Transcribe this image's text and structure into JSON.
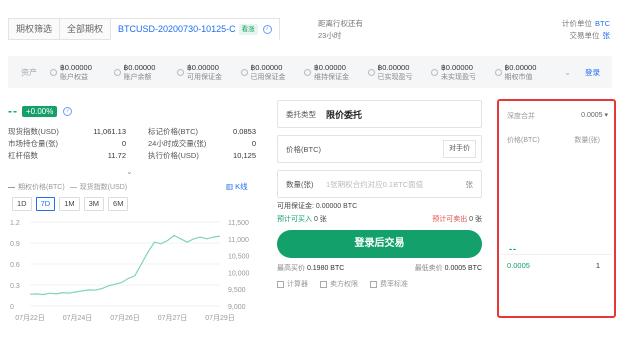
{
  "tabs": [
    {
      "label": "期权筛选"
    },
    {
      "label": "全部期权"
    },
    {
      "label": "BTCUSD-20200730-10125-C",
      "badge": "看涨"
    }
  ],
  "expiry": {
    "label": "距离行权还有",
    "value": "23小时"
  },
  "units": {
    "price_label": "计价单位",
    "price_value": "BTC",
    "trade_label": "交易单位",
    "trade_value": "张"
  },
  "assets": {
    "label": "资产",
    "items": [
      {
        "value": "฿0.00000",
        "name": "账户权益"
      },
      {
        "value": "฿0.00000",
        "name": "账户余额"
      },
      {
        "value": "฿0.00000",
        "name": "可用保证金"
      },
      {
        "value": "฿0.00000",
        "name": "已用保证金"
      },
      {
        "value": "฿0.00000",
        "name": "维持保证金"
      },
      {
        "value": "฿0.00000",
        "name": "已实现盈亏"
      },
      {
        "value": "฿0.00000",
        "name": "未实现盈亏"
      },
      {
        "value": "฿0.00000",
        "name": "期权市值"
      }
    ],
    "login": "登录"
  },
  "ticker": {
    "price": "--",
    "change": "+0.00%"
  },
  "stats": [
    {
      "k1": "现货指数(USD)",
      "v1": "11,061.13",
      "k2": "标记价格(BTC)",
      "v2": "0.0853"
    },
    {
      "k1": "市场持仓量(张)",
      "v1": "0",
      "k2": "24小时成交量(张)",
      "v2": "0"
    },
    {
      "k1": "杠杆倍数",
      "v1": "11.72",
      "k2": "执行价格(USD)",
      "v2": "10,125"
    }
  ],
  "legend": {
    "mark": "期权价格(BTC)",
    "index": "现货指数(USD)",
    "kline": "K线"
  },
  "ranges": [
    "1D",
    "7D",
    "1M",
    "3M",
    "6M"
  ],
  "chart_data": {
    "type": "line",
    "x": [
      "07月22日",
      "07月24日",
      "07月26日",
      "07月27日",
      "07月29日"
    ],
    "ylim_left": [
      0,
      1.2
    ],
    "yticks_left": [
      "1.2",
      "0.9",
      "0.6",
      "0.3",
      "0"
    ],
    "ylim_right": [
      9000,
      11500
    ],
    "yticks_right": [
      "11,500",
      "11,000",
      "10,500",
      "10,000",
      "9,500",
      "9,000"
    ],
    "series": [
      {
        "name": "现货指数(USD)",
        "axis": "right",
        "values": [
          9350,
          9360,
          9340,
          9380,
          9360,
          9400,
          9380,
          9420,
          9450,
          9480,
          9470,
          9520,
          9600,
          9650,
          9700,
          9820,
          9900,
          10250,
          10600,
          10900,
          10850,
          10950,
          11100,
          11000,
          10900,
          11000,
          11050,
          11000,
          11050,
          11080
        ]
      }
    ]
  },
  "form": {
    "order_type_label": "委托类型",
    "order_type_value": "限价委托",
    "price_placeholder": "价格(BTC)",
    "counterparty_btn": "对手价",
    "qty_label": "数量(张)",
    "qty_placeholder": "1张期权合约对应0.1BTC面值",
    "qty_unit": "张",
    "avail": "可用保证金: 0.00000 BTC",
    "can_buy_label": "预计可买入",
    "can_buy_value": "0 张",
    "can_sell_label": "预计可卖出",
    "can_sell_value": "0 张",
    "submit": "登录后交易",
    "max_buy_label": "最高买价",
    "max_buy_value": "0.1980 BTC",
    "min_sell_label": "最低卖价",
    "min_sell_value": "0.0005 BTC",
    "links": [
      "计算器",
      "卖方权限",
      "费率标准"
    ]
  },
  "book": {
    "depth_label": "深度合并",
    "depth_value": "0.0005",
    "col_price": "价格(BTC)",
    "col_qty": "数量(张)",
    "last": "--",
    "rows": [
      {
        "price": "0.0005",
        "qty": "1"
      }
    ]
  },
  "colors": {
    "accent": "#1e6ff0",
    "green": "#14a06a",
    "red": "#e0504b",
    "highlight": "#e53935"
  }
}
